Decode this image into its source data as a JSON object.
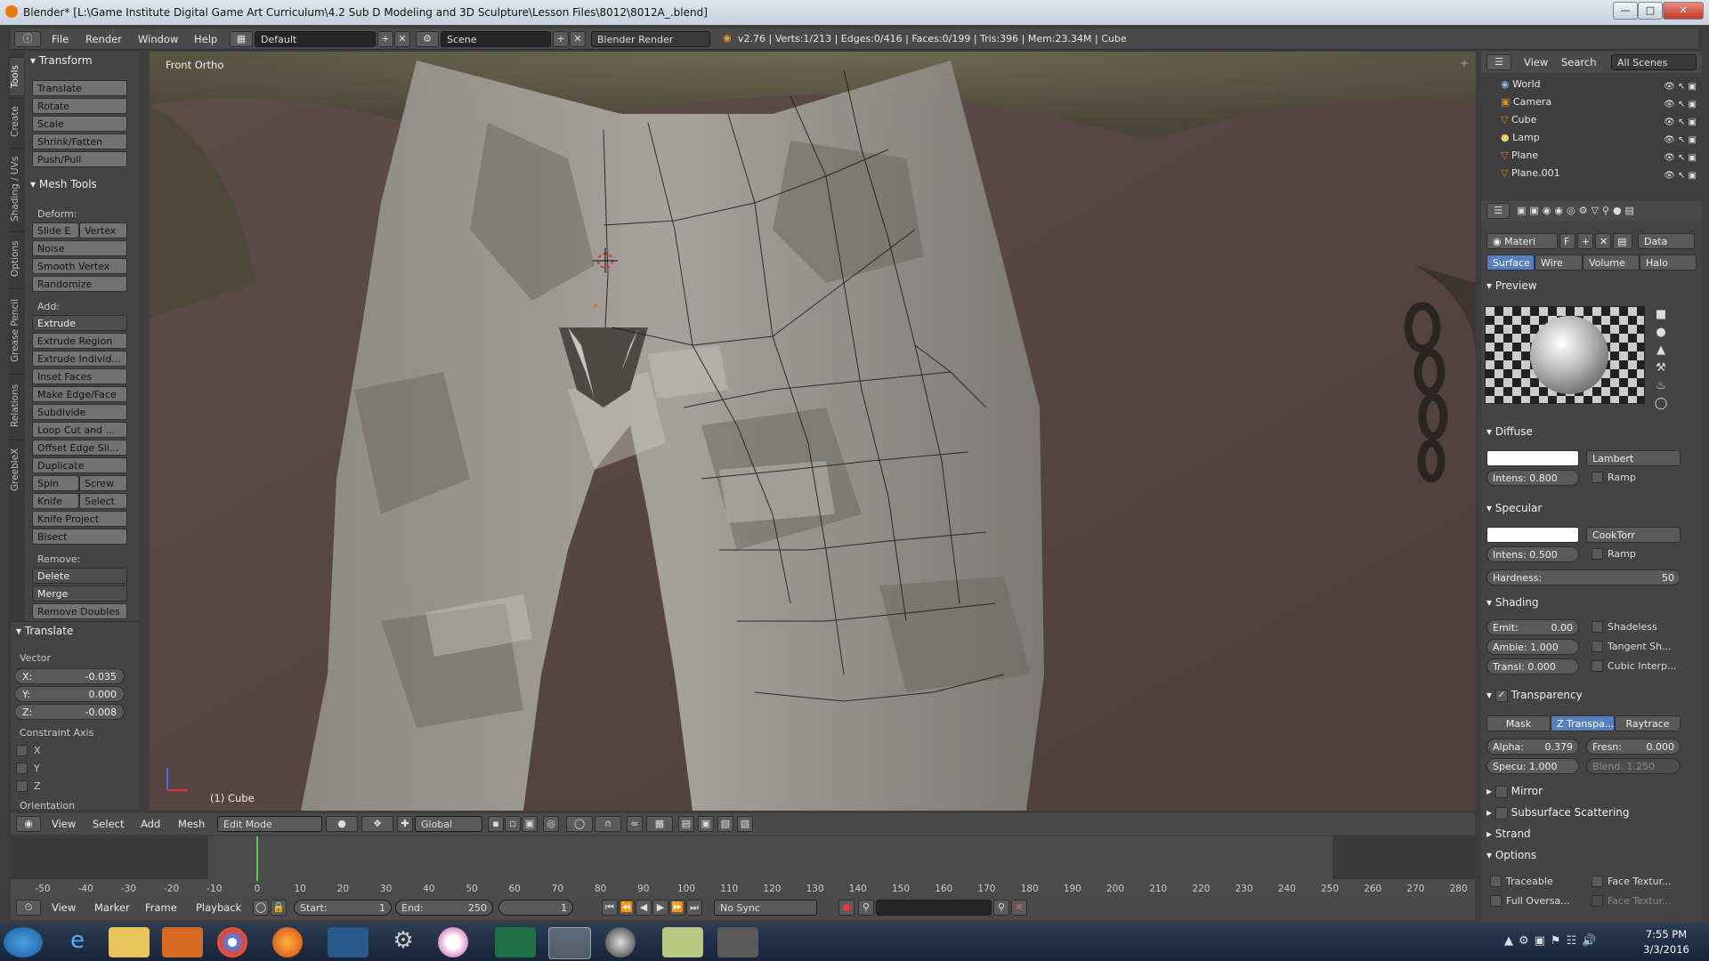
{
  "window": {
    "title": "Blender* [L:\\Game Institute Digital Game Art  Curriculum\\4.2 Sub D Modeling and 3D Sculpture\\Lesson Files\\8012\\8012A_.blend]"
  },
  "infobar": {
    "menus": [
      "File",
      "Render",
      "Window",
      "Help"
    ],
    "layout": "Default",
    "scene": "Scene",
    "engine": "Blender Render",
    "stats": "v2.76 | Verts:1/213 | Edges:0/416 | Faces:0/199 | Tris:396 | Mem:23.34M | Cube"
  },
  "left_tabs": [
    "Tools",
    "Create",
    "Shading / UVs",
    "Options",
    "Grease Pencil",
    "Relations",
    "GreebleX"
  ],
  "toolshelf": {
    "transform_header": "Transform",
    "transform": [
      "Translate",
      "Rotate",
      "Scale",
      "Shrink/Fatten",
      "Push/Pull"
    ],
    "meshtools_header": "Mesh Tools",
    "deform_label": "Deform:",
    "slide_e": "Slide E",
    "vertex": "Vertex",
    "noise": "Noise",
    "smooth_vertex": "Smooth Vertex",
    "randomize": "Randomize",
    "add_label": "Add:",
    "extrude": "Extrude",
    "add": [
      "Extrude Region",
      "Extrude Individ...",
      "Inset Faces",
      "Make Edge/Face",
      "Subdivide",
      "Loop Cut and ...",
      "Offset Edge Sli...",
      "Duplicate"
    ],
    "spin": "Spin",
    "screw": "Screw",
    "knife": "Knife",
    "select": "Select",
    "knife_project": "Knife Project",
    "bisect": "Bisect",
    "remove_label": "Remove:",
    "delete": "Delete",
    "merge": "Merge",
    "remove_doubles": "Remove Doubles",
    "translate_header": "Translate",
    "vector_label": "Vector",
    "x": "X:",
    "x_val": "-0.035",
    "y": "Y:",
    "y_val": "0.000",
    "z": "Z:",
    "z_val": "-0.008",
    "constraint_label": "Constraint Axis",
    "axes": [
      "X",
      "Y",
      "Z"
    ],
    "orientation_label": "Orientation"
  },
  "viewport": {
    "view_label": "Front Ortho",
    "object_label": "(1) Cube"
  },
  "viewhdr": {
    "menus": [
      "View",
      "Select",
      "Add",
      "Mesh"
    ],
    "mode": "Edit Mode",
    "orientation": "Global"
  },
  "timeline": {
    "ticks": [
      "-50",
      "-40",
      "-30",
      "-20",
      "-10",
      "0",
      "10",
      "20",
      "30",
      "40",
      "50",
      "60",
      "70",
      "80",
      "90",
      "100",
      "110",
      "120",
      "130",
      "140",
      "150",
      "160",
      "170",
      "180",
      "190",
      "200",
      "210",
      "220",
      "230",
      "240",
      "250",
      "260",
      "270",
      "280"
    ],
    "current_frame_value": 0
  },
  "timehdr": {
    "menus": [
      "View",
      "Marker",
      "Frame",
      "Playback"
    ],
    "start": "Start:",
    "start_val": "1",
    "end": "End:",
    "end_val": "250",
    "current": "1",
    "sync": "No Sync"
  },
  "outliner": {
    "menus": [
      "View",
      "Search"
    ],
    "scenes": "All Scenes",
    "items": [
      "World",
      "Camera",
      "Cube",
      "Lamp",
      "Plane",
      "Plane.001"
    ]
  },
  "properties": {
    "material_name": "Materi",
    "f_label": "F",
    "data_label": "Data",
    "tabs": [
      "Surface",
      "Wire",
      "Volume",
      "Halo"
    ],
    "preview_header": "Preview",
    "diffuse_header": "Diffuse",
    "diffuse_shader": "Lambert",
    "diffuse_intens": "Intens: 0.800",
    "ramp": "Ramp",
    "specular_header": "Specular",
    "specular_shader": "CookTorr",
    "specular_intens": "Intens: 0.500",
    "hardness_label": "Hardness:",
    "hardness_val": "50",
    "shading_header": "Shading",
    "emit": "Emit:",
    "emit_val": "0.00",
    "ambie": "Ambie: 1.000",
    "transl": "Transl: 0.000",
    "shadeless": "Shadeless",
    "tangent": "Tangent Sh...",
    "cubic": "Cubic Interp...",
    "transparency_header": "Transparency",
    "trans_tabs": [
      "Mask",
      "Z Transpa...",
      "Raytrace"
    ],
    "alpha": "Alpha:",
    "alpha_val": "0.379",
    "fresnel": "Fresn:",
    "fresnel_val": "0.000",
    "specu": "Specu: 1.000",
    "blend": "Blend: 1.250",
    "mirror_header": "Mirror",
    "sss_header": "Subsurface Scattering",
    "strand_header": "Strand",
    "options_header": "Options",
    "traceable": "Traceable",
    "face_textur": "Face Textur...",
    "full_oversa": "Full Oversa...",
    "face_textur2": "Face Textur..."
  },
  "taskbar": {
    "time": "7:55 PM",
    "date": "3/3/2016"
  }
}
